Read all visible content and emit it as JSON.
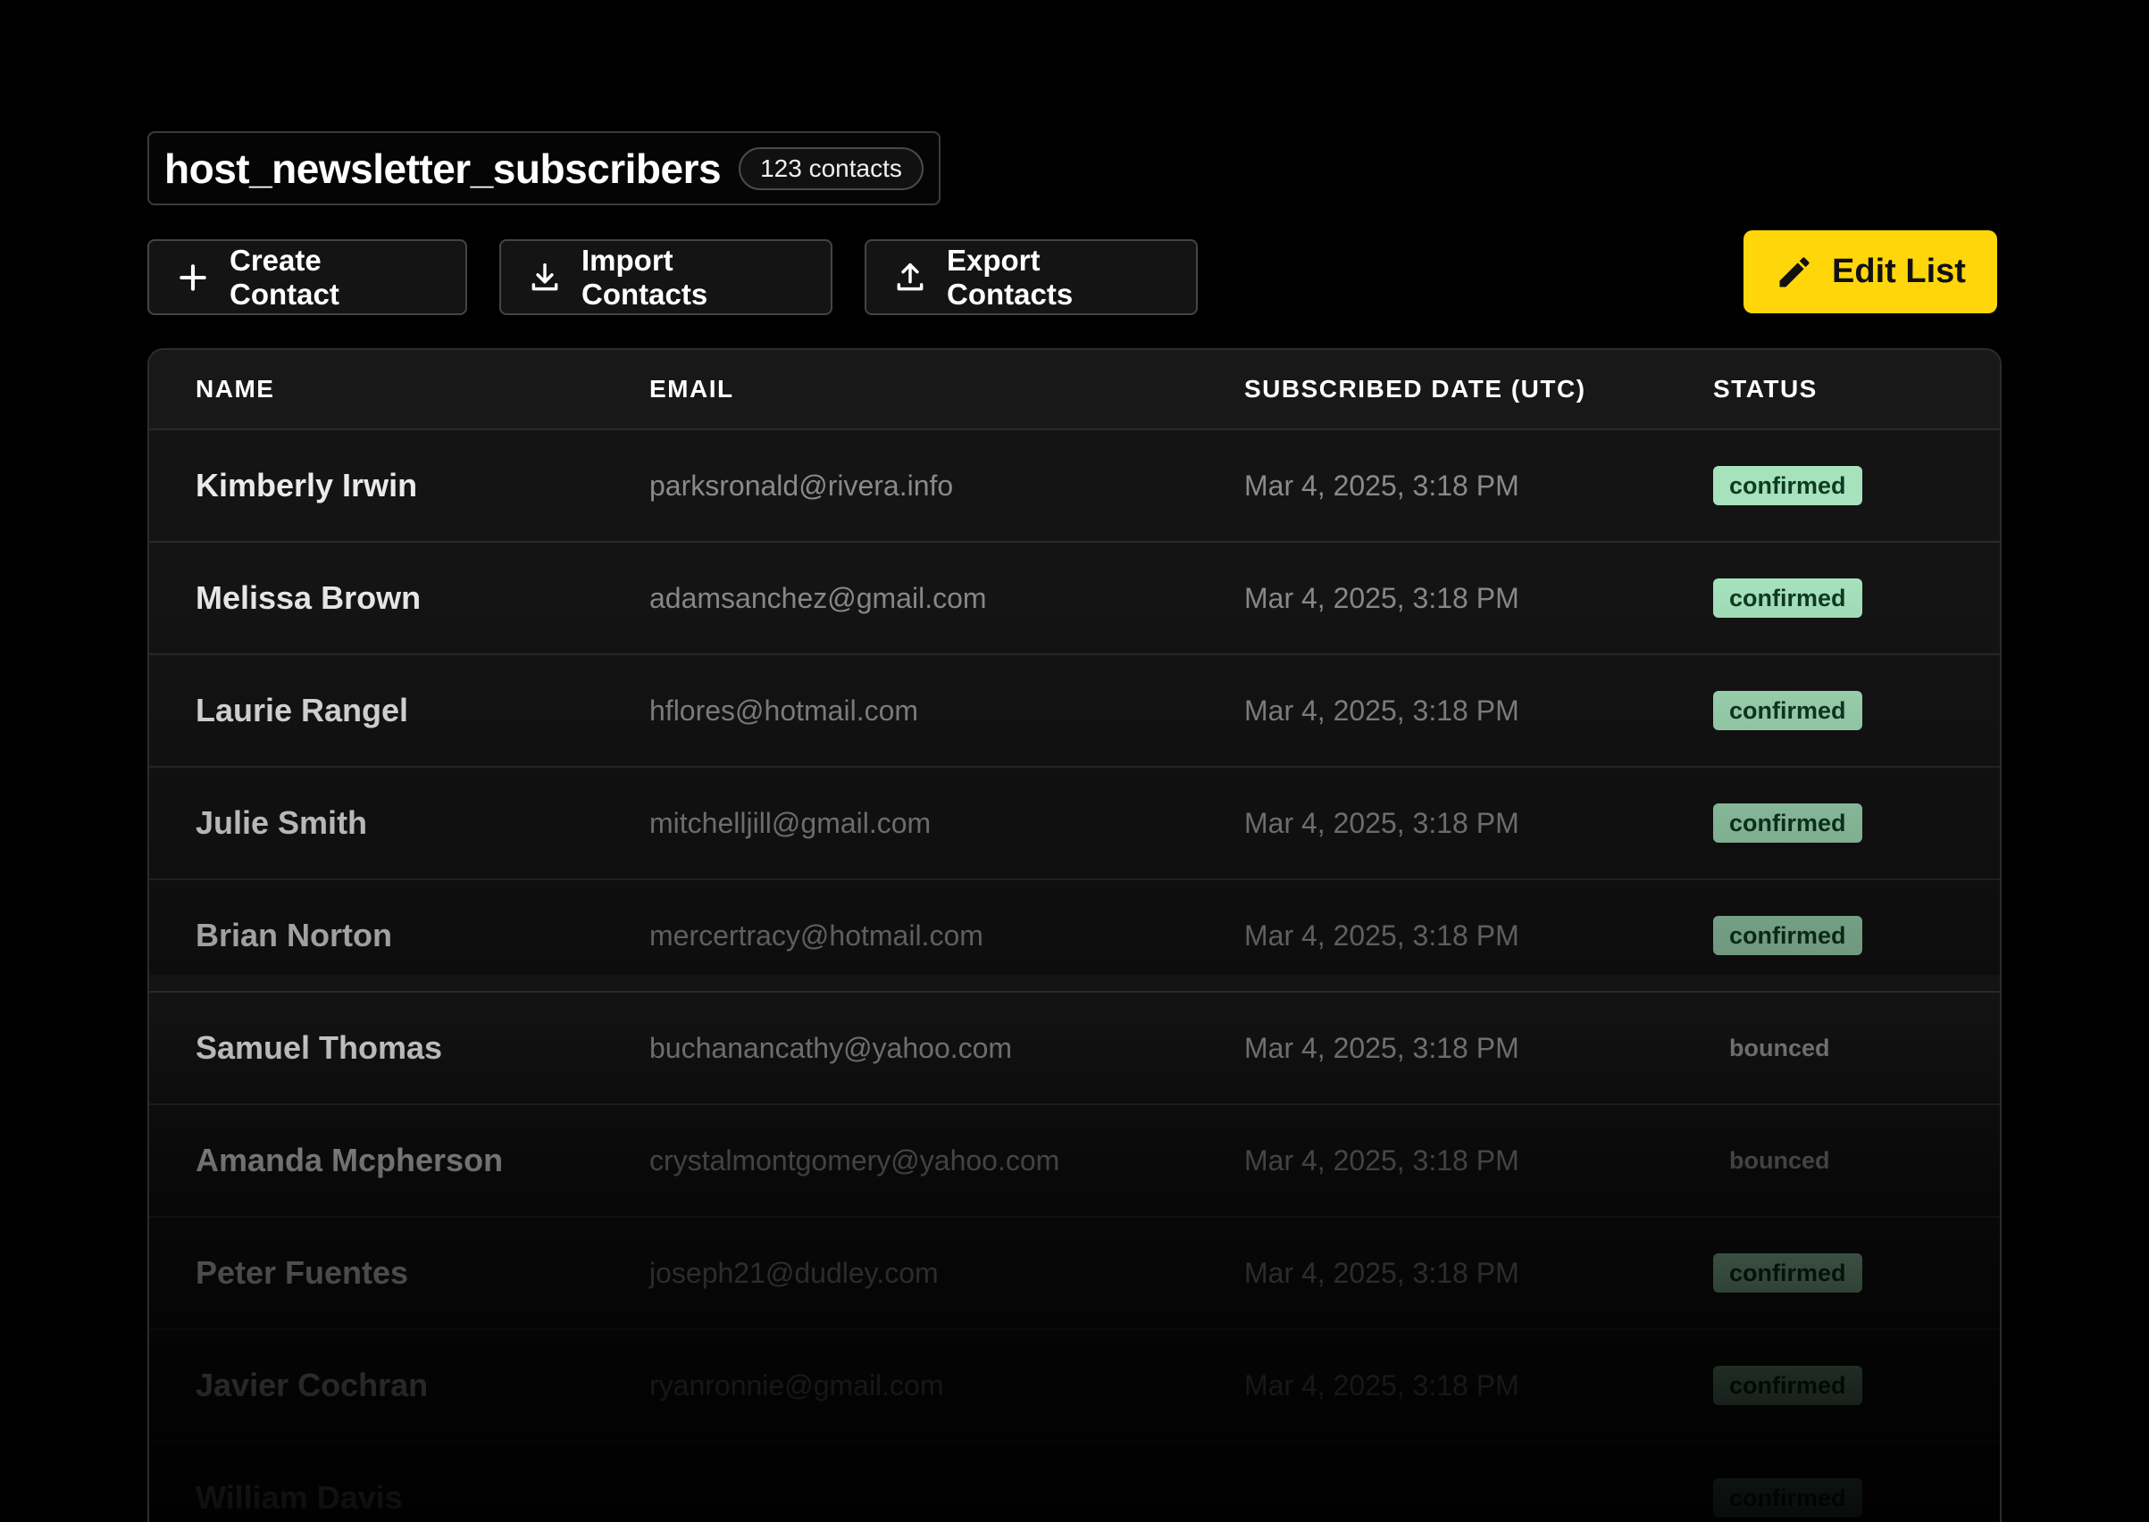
{
  "list": {
    "title": "host_newsletter_subscribers",
    "count_label": "123 contacts"
  },
  "actions": {
    "create_label": "Create Contact",
    "import_label": "Import Contacts",
    "export_label": "Export Contacts",
    "edit_label": "Edit List"
  },
  "icons": {
    "create": "plus-icon",
    "import": "download-icon",
    "export": "upload-icon",
    "edit": "pencil-icon"
  },
  "colors": {
    "accent": "#ffd60a",
    "confirmed_bg": "#a6e3bd",
    "confirmed_text": "#103a22"
  },
  "table": {
    "columns": [
      "NAME",
      "EMAIL",
      "SUBSCRIBED DATE (UTC)",
      "STATUS"
    ],
    "rows": [
      {
        "name": "Kimberly Irwin",
        "email": "parksronald@rivera.info",
        "date": "Mar 4, 2025, 3:18 PM",
        "status": "confirmed"
      },
      {
        "name": "Melissa Brown",
        "email": "adamsanchez@gmail.com",
        "date": "Mar 4, 2025, 3:18 PM",
        "status": "confirmed"
      },
      {
        "name": "Laurie Rangel",
        "email": "hflores@hotmail.com",
        "date": "Mar 4, 2025, 3:18 PM",
        "status": "confirmed"
      },
      {
        "name": "Julie Smith",
        "email": "mitchelljill@gmail.com",
        "date": "Mar 4, 2025, 3:18 PM",
        "status": "confirmed"
      },
      {
        "name": "Brian Norton",
        "email": "mercertracy@hotmail.com",
        "date": "Mar 4, 2025, 3:18 PM",
        "status": "confirmed"
      },
      {
        "name": "Samuel Thomas",
        "email": "buchanancathy@yahoo.com",
        "date": "Mar 4, 2025, 3:18 PM",
        "status": "bounced"
      },
      {
        "name": "Amanda Mcpherson",
        "email": "crystalmontgomery@yahoo.com",
        "date": "Mar 4, 2025, 3:18 PM",
        "status": "bounced"
      },
      {
        "name": "Peter Fuentes",
        "email": "joseph21@dudley.com",
        "date": "Mar 4, 2025, 3:18 PM",
        "status": "confirmed"
      },
      {
        "name": "Javier Cochran",
        "email": "ryanronnie@gmail.com",
        "date": "Mar 4, 2025, 3:18 PM",
        "status": "confirmed"
      },
      {
        "name": "William Davis",
        "email": "",
        "date": "",
        "status": "confirmed"
      }
    ]
  }
}
